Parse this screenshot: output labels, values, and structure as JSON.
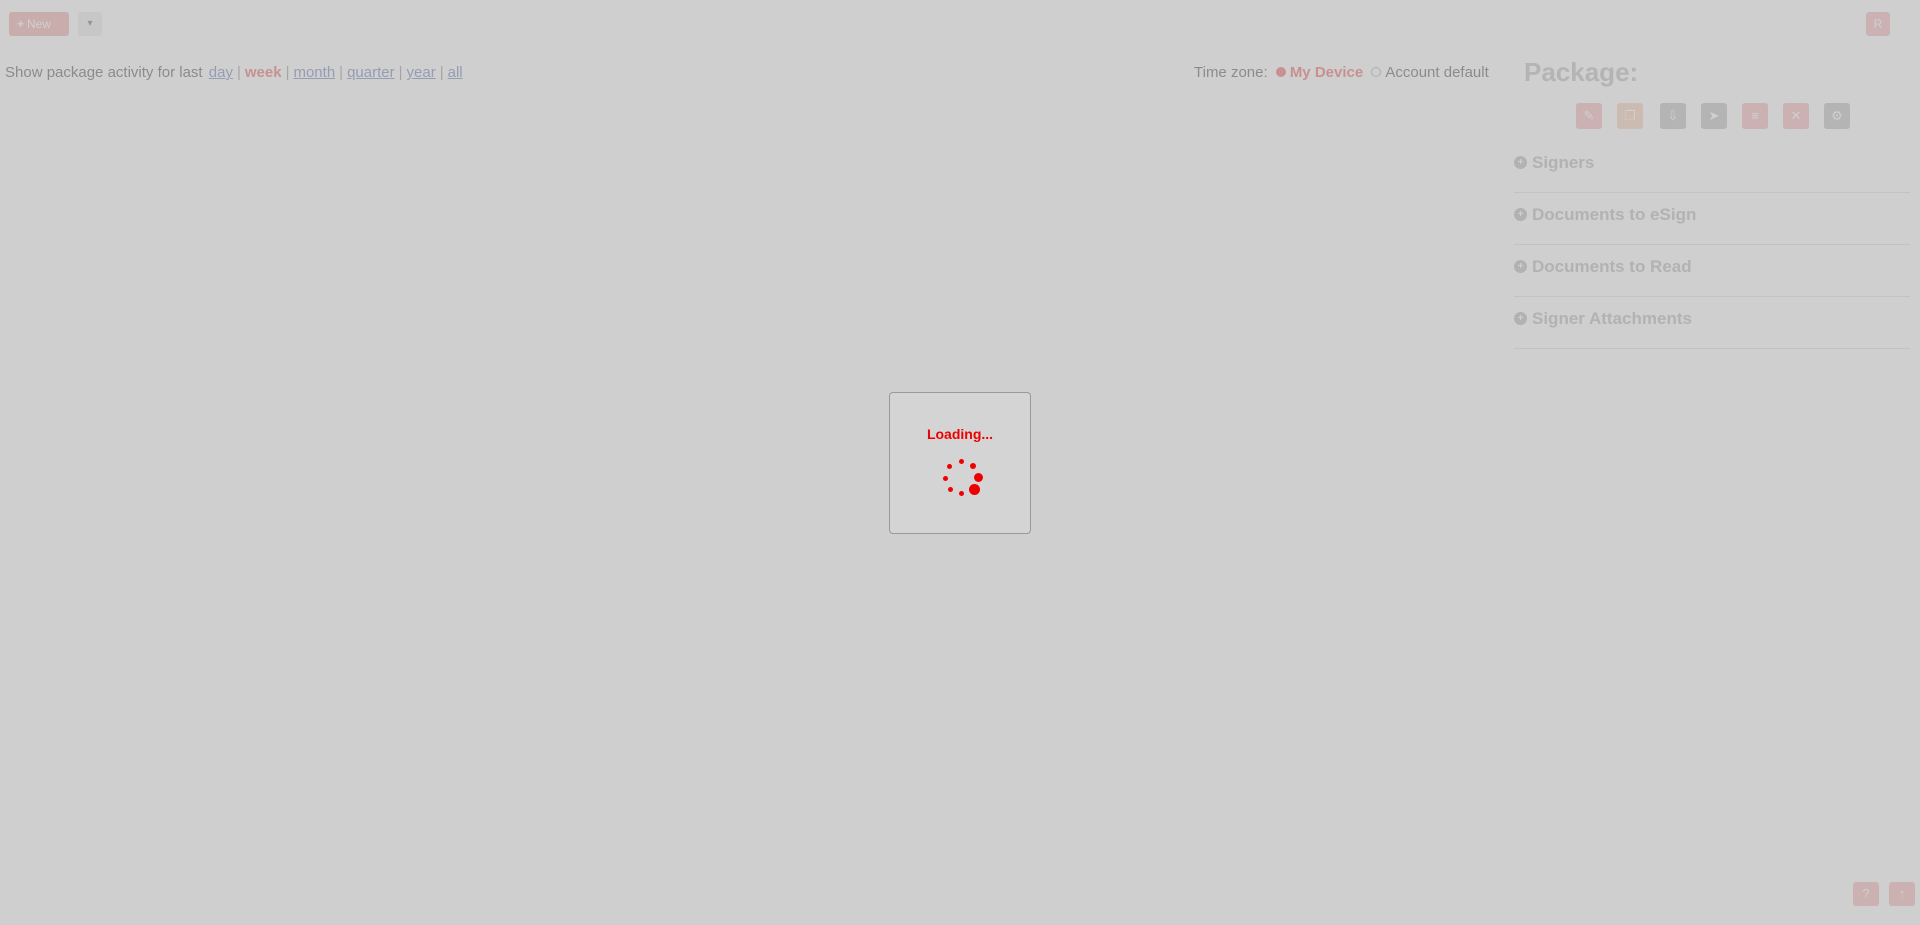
{
  "topbar": {
    "new_label": "New",
    "dropdown_glyph": "▾",
    "user_initial": "R"
  },
  "activity": {
    "prefix": "Show package activity for last",
    "periods": [
      "day",
      "week",
      "month",
      "quarter",
      "year",
      "all"
    ],
    "active_period": "week"
  },
  "timezone": {
    "label": "Time zone:",
    "option_device": "My Device",
    "option_account": "Account default",
    "selected": "My Device"
  },
  "package": {
    "title": "Package:",
    "icons": [
      {
        "name": "edit-icon",
        "glyph": "✎",
        "color": "#f6c2c2"
      },
      {
        "name": "duplicate-icon",
        "glyph": "❐",
        "color": "#f6d6c2"
      },
      {
        "name": "download-icon",
        "glyph": "⇩",
        "color": "#c8c8c8"
      },
      {
        "name": "send-icon",
        "glyph": "➤",
        "color": "#c8c8c8"
      },
      {
        "name": "audit-icon",
        "glyph": "≡",
        "color": "#f6c2c2"
      },
      {
        "name": "delete-icon",
        "glyph": "✕",
        "color": "#f6c2c2"
      },
      {
        "name": "settings-icon",
        "glyph": "⚙",
        "color": "#c8c8c8"
      }
    ],
    "sections": [
      {
        "label": "Signers"
      },
      {
        "label": "Documents to eSign"
      },
      {
        "label": "Documents to Read"
      },
      {
        "label": "Signer Attachments"
      }
    ]
  },
  "bottom_buttons": [
    {
      "name": "help-icon",
      "glyph": "?"
    },
    {
      "name": "scroll-top-icon",
      "glyph": "↑"
    }
  ],
  "loading": {
    "text": "Loading..."
  },
  "colors": {
    "accent": "#ee0000",
    "overlay": "rgba(160,160,160,0.5)"
  }
}
